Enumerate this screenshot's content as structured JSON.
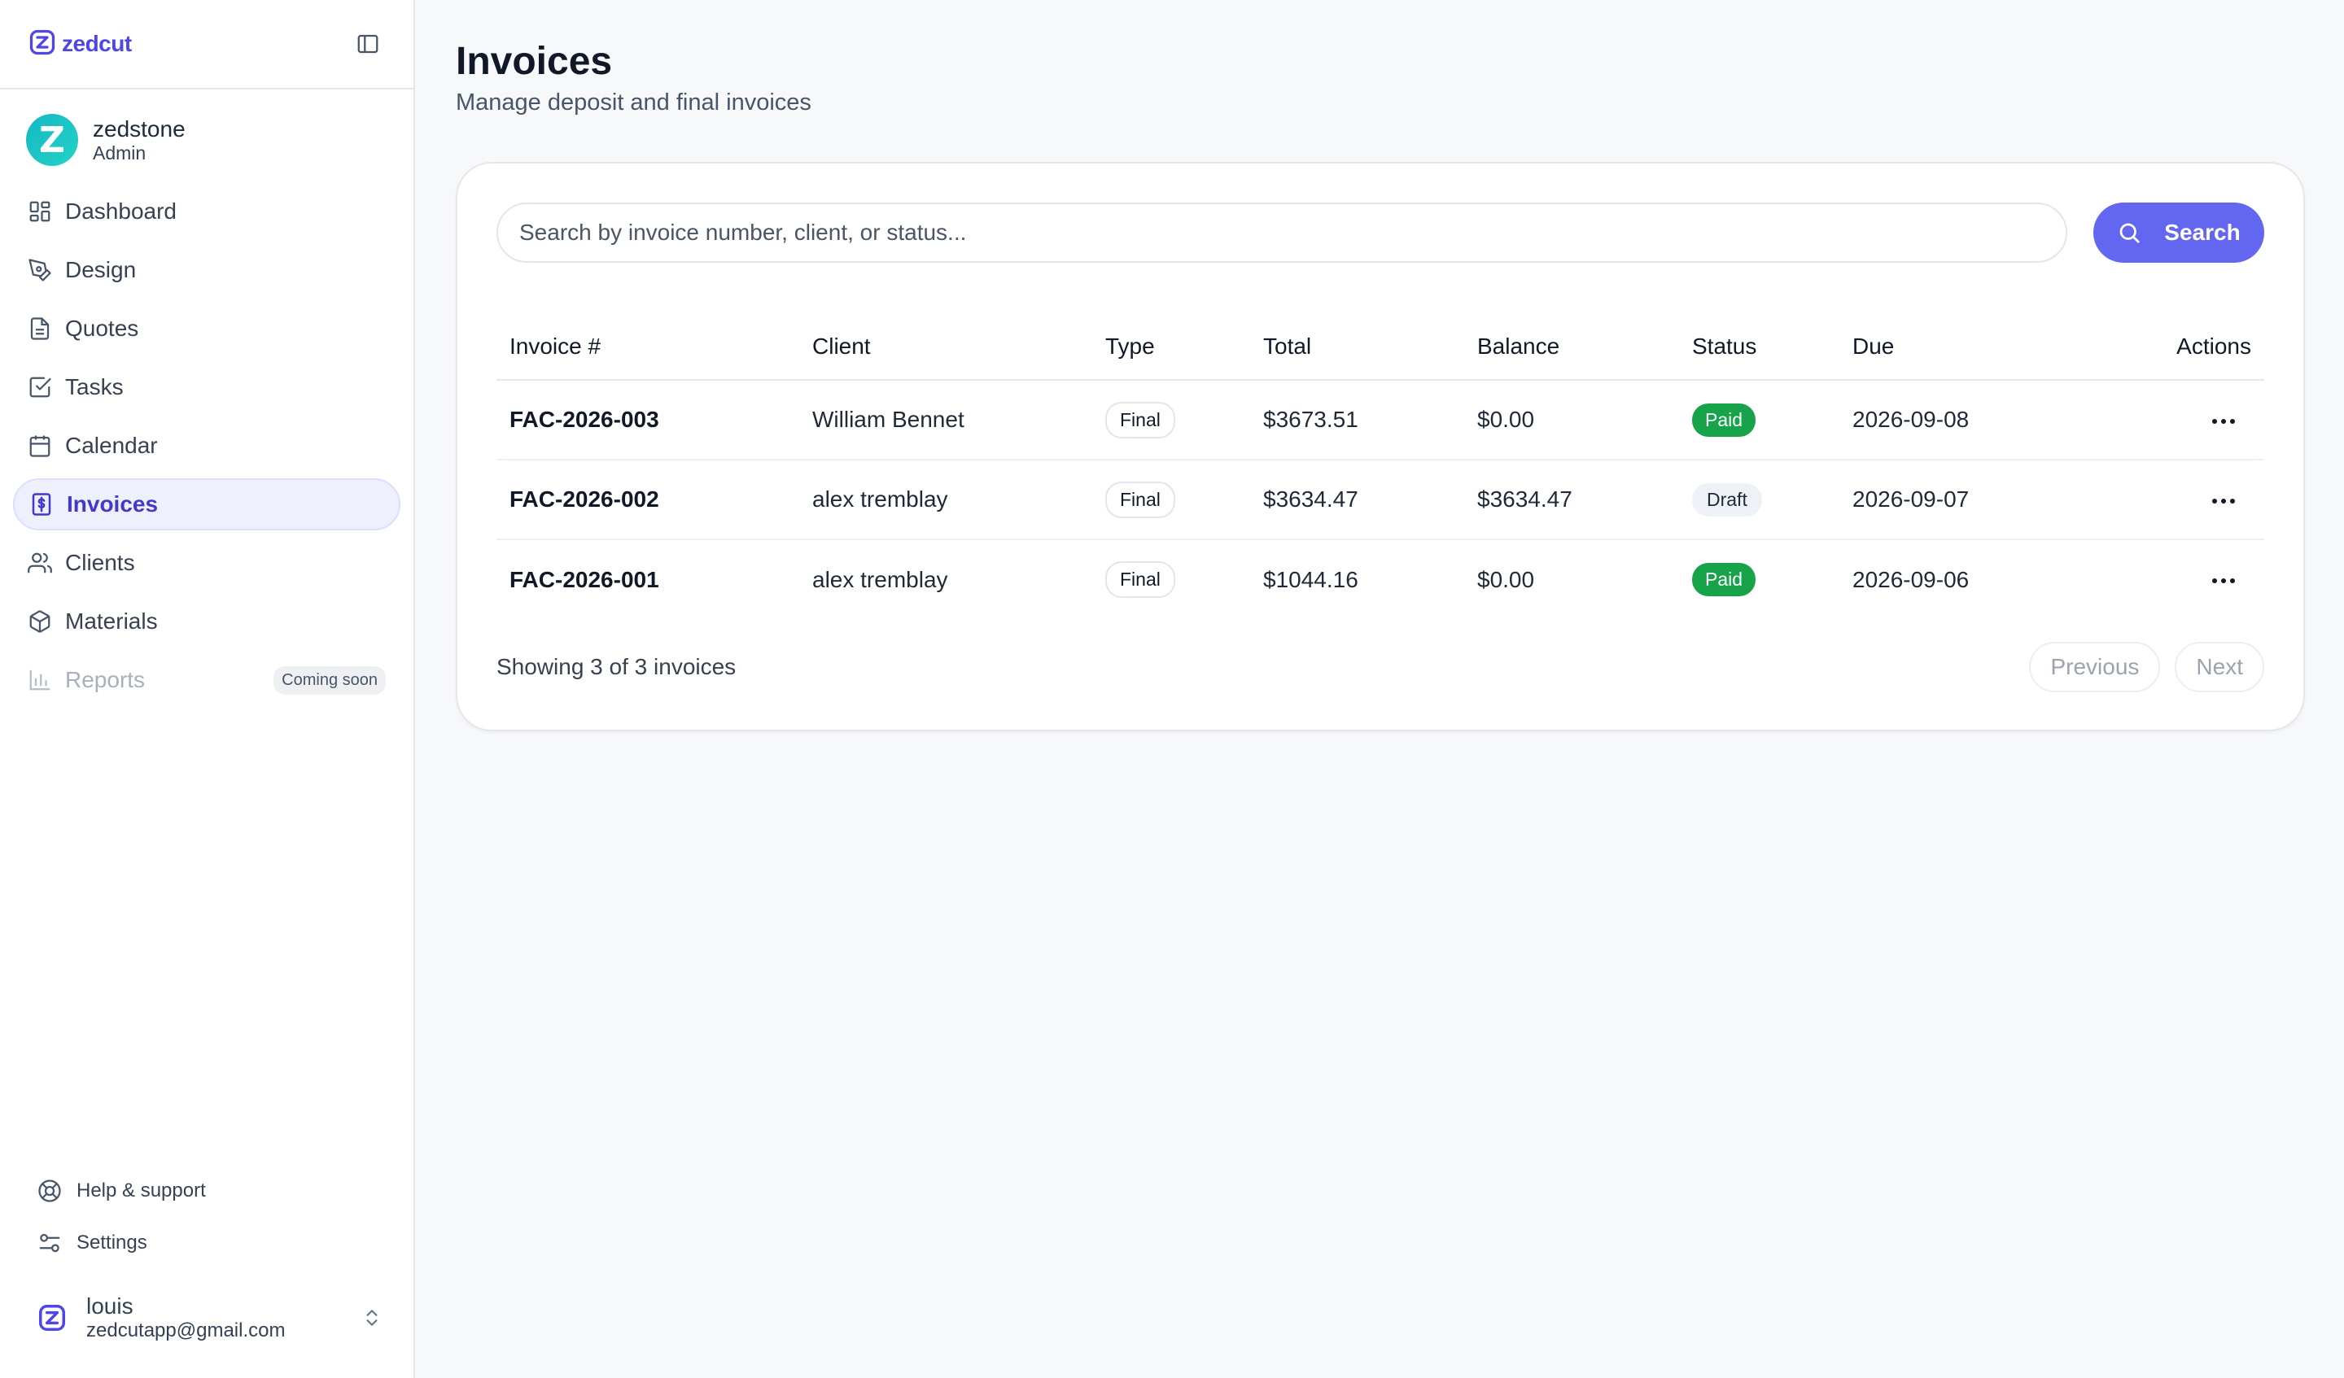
{
  "brand": {
    "name": "zedcut"
  },
  "profile": {
    "name": "zedstone",
    "role": "Admin",
    "avatar_letter": "Z"
  },
  "nav": [
    {
      "label": "Dashboard",
      "icon": "dashboard-icon"
    },
    {
      "label": "Design",
      "icon": "pen-tool-icon"
    },
    {
      "label": "Quotes",
      "icon": "document-icon"
    },
    {
      "label": "Tasks",
      "icon": "check-square-icon"
    },
    {
      "label": "Calendar",
      "icon": "calendar-icon"
    },
    {
      "label": "Invoices",
      "icon": "dollar-receipt-icon",
      "active": true
    },
    {
      "label": "Clients",
      "icon": "users-icon"
    },
    {
      "label": "Materials",
      "icon": "box-icon"
    },
    {
      "label": "Reports",
      "icon": "bar-chart-icon",
      "disabled": true,
      "badge": "Coming soon"
    }
  ],
  "footer": {
    "help": "Help & support",
    "settings": "Settings"
  },
  "user": {
    "name": "louis",
    "email": "zedcutapp@gmail.com"
  },
  "page": {
    "title": "Invoices",
    "subtitle": "Manage deposit and final invoices"
  },
  "search": {
    "placeholder": "Search by invoice number, client, or status...",
    "button": "Search"
  },
  "table": {
    "headers": [
      "Invoice #",
      "Client",
      "Type",
      "Total",
      "Balance",
      "Status",
      "Due",
      "Actions"
    ],
    "rows": [
      {
        "invoice": "FAC-2026-003",
        "client": "William Bennet",
        "type": "Final",
        "total": "$3673.51",
        "balance": "$0.00",
        "status": "Paid",
        "due": "2026-09-08"
      },
      {
        "invoice": "FAC-2026-002",
        "client": "alex tremblay",
        "type": "Final",
        "total": "$3634.47",
        "balance": "$3634.47",
        "status": "Draft",
        "due": "2026-09-07"
      },
      {
        "invoice": "FAC-2026-001",
        "client": "alex tremblay",
        "type": "Final",
        "total": "$1044.16",
        "balance": "$0.00",
        "status": "Paid",
        "due": "2026-09-06"
      }
    ]
  },
  "pagination": {
    "summary": "Showing 3 of 3 invoices",
    "previous": "Previous",
    "next": "Next"
  },
  "colors": {
    "accent": "#6366f1",
    "paid": "#16a34a",
    "brand": "#4f46e5"
  }
}
